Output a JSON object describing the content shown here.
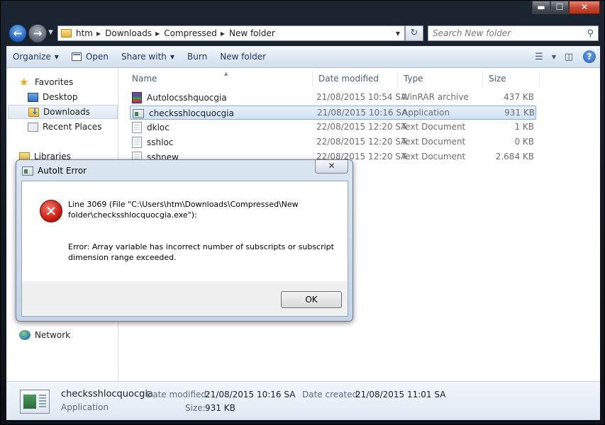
{
  "window": {
    "caption_buttons": {
      "minimize": "▬",
      "maximize": "☐",
      "close": "✕"
    }
  },
  "address_bar": {
    "breadcrumbs": [
      "htm",
      "Downloads",
      "Compressed",
      "New folder"
    ],
    "separator": "▶",
    "search_placeholder": "Search New folder"
  },
  "toolbar": {
    "organize": "Organize",
    "open": "Open",
    "share_with": "Share with",
    "burn": "Burn",
    "new_folder": "New folder"
  },
  "nav_pane": {
    "favorites": "Favorites",
    "desktop": "Desktop",
    "downloads": "Downloads",
    "recent_places": "Recent Places",
    "libraries": "Libraries",
    "network": "Network"
  },
  "columns": {
    "name": "Name",
    "date_modified": "Date modified",
    "type": "Type",
    "size": "Size"
  },
  "files": [
    {
      "name": "Autolocsshquocgia",
      "date": "21/08/2015 10:54 SA",
      "type": "WinRAR archive",
      "size": "437 KB",
      "icon": "winrar-archive-icon"
    },
    {
      "name": "checksshlocquocgia",
      "date": "21/08/2015 10:16 SA",
      "type": "Application",
      "size": "931 KB",
      "icon": "application-icon",
      "selected": true
    },
    {
      "name": "dkloc",
      "date": "22/08/2015 12:20 SA",
      "type": "Text Document",
      "size": "1 KB",
      "icon": "text-document-icon"
    },
    {
      "name": "sshloc",
      "date": "22/08/2015 12:20 SA",
      "type": "Text Document",
      "size": "0 KB",
      "icon": "text-document-icon"
    },
    {
      "name": "sshnew",
      "date": "22/08/2015 12:20 SA",
      "type": "Text Document",
      "size": "2.684 KB",
      "icon": "text-document-icon"
    }
  ],
  "details": {
    "name": "checksshlocquocgia",
    "kind": "Application",
    "date_modified_label": "Date modified:",
    "date_modified": "21/08/2015 10:16 SA",
    "date_created_label": "Date created:",
    "date_created": "21/08/2015 11:01 SA",
    "size_label": "Size:",
    "size": "931 KB"
  },
  "dialog": {
    "title": "AutoIt Error",
    "close": "✕",
    "line1": "Line 3069  (File \"C:\\Users\\htm\\Downloads\\Compressed\\New",
    "line2": "folder\\checksshlocquocgia.exe\"):",
    "line3": "Error: Array variable has incorrect number of subscripts or subscript",
    "line4": "dimension range exceeded.",
    "ok": "OK"
  }
}
